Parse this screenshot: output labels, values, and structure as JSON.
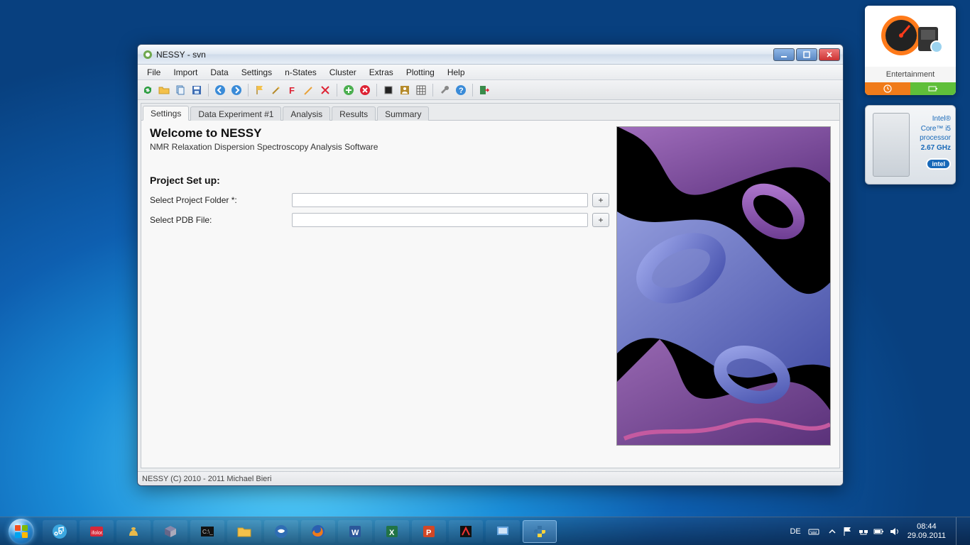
{
  "window": {
    "title": "NESSY - svn"
  },
  "menu": {
    "items": [
      "File",
      "Import",
      "Data",
      "Settings",
      "n-States",
      "Cluster",
      "Extras",
      "Plotting",
      "Help"
    ]
  },
  "toolbar": {
    "icons": [
      "refresh-icon",
      "folder-icon",
      "copy-icon",
      "save-icon",
      "sep",
      "back-icon",
      "forward-icon",
      "sep",
      "flag-icon",
      "wizard-icon",
      "f-letter-icon",
      "edit-icon",
      "delete-x-icon",
      "sep",
      "add-green-icon",
      "remove-red-icon",
      "sep",
      "stop-icon",
      "user-icon",
      "grid-icon",
      "sep",
      "wrench-icon",
      "help-icon",
      "sep",
      "exit-icon"
    ]
  },
  "tabs": {
    "items": [
      "Settings",
      "Data Experiment #1",
      "Analysis",
      "Results",
      "Summary"
    ],
    "active_index": 0
  },
  "settings": {
    "welcome_title": "Welcome to NESSY",
    "welcome_sub": "NMR Relaxation Dispersion Spectroscopy Analysis Software",
    "section_title": "Project Set up:",
    "rows": [
      {
        "label": "Select Project Folder *:",
        "value": "",
        "button": "+"
      },
      {
        "label": "Select PDB File:",
        "value": "",
        "button": "+"
      }
    ]
  },
  "statusbar": {
    "text": "NESSY (C) 2010 - 2011 Michael Bieri"
  },
  "gadgets": {
    "she_label": "Entertainment",
    "cpu": {
      "line1": "Intel®",
      "line2": "Core™ i5",
      "line3": "processor",
      "line4": "2.67 GHz",
      "badge": "intel"
    }
  },
  "taskbar": {
    "pins": [
      "itunes-icon",
      "ifolor-icon",
      "genie-icon",
      "virtualbox-icon",
      "cmd-icon",
      "explorer-icon",
      "thunderbird-icon",
      "firefox-icon",
      "word-icon",
      "excel-icon",
      "powerpoint-icon",
      "acrobat-icon",
      "generic-app-icon",
      "python-icon"
    ],
    "active_pin_index": 13,
    "tray": {
      "lang": "DE",
      "time": "08:44",
      "date": "29.09.2011"
    }
  }
}
